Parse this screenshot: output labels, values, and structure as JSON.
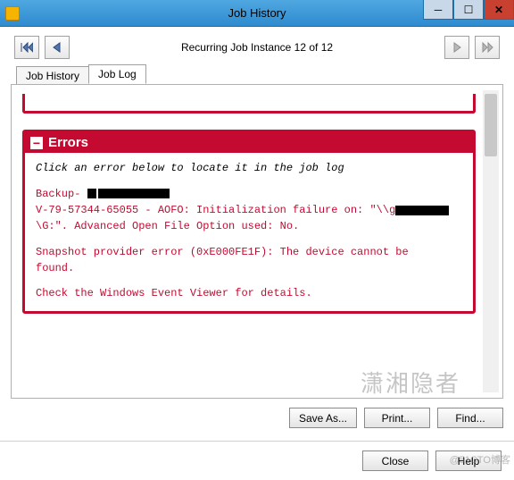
{
  "window": {
    "title": "Job History"
  },
  "nav": {
    "instance_text": "Recurring Job Instance 12 of 12"
  },
  "tabs": {
    "history": "Job History",
    "log": "Job Log"
  },
  "errors": {
    "heading": "Errors",
    "hint": "Click an error below to locate it in the job log",
    "backup_label": "Backup- ",
    "line_code_a": "V-79-57344-65055 - AOFO: Initialization failure on: \"\\\\g",
    "line_code_b": "\\G:\". Advanced Open File Option used: No.",
    "snapshot_a": "Snapshot provider error (0xE000FE1F): The device cannot be",
    "snapshot_b": "found.",
    "event_viewer": "Check the Windows Event Viewer for details."
  },
  "panel_buttons": {
    "save_as": "Save As...",
    "print": "Print...",
    "find": "Find..."
  },
  "dialog_buttons": {
    "close": "Close",
    "help": "Help"
  },
  "watermark": "潇湘隐者",
  "watermark2": "@51CTO博客"
}
